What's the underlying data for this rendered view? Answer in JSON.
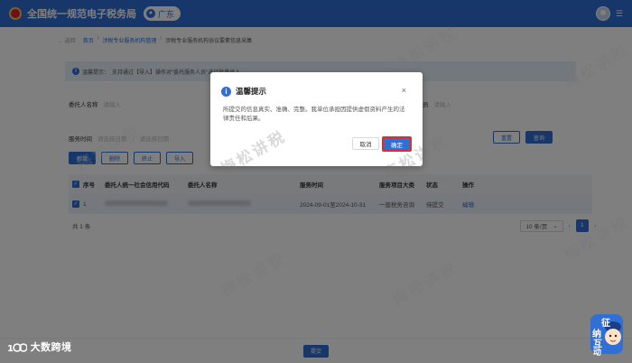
{
  "header": {
    "title": "全国统一规范电子税务局",
    "region": "广东"
  },
  "breadcrumb": {
    "back": "返回",
    "items": [
      "首页",
      "涉税专业服务机构管理",
      "涉税专业服务机构协议要素信息采集"
    ]
  },
  "notice": {
    "prefix": "温馨提示：",
    "text": "支持通过【导入】操作对\"委托服务人员\"进行批量录入。"
  },
  "filters": {
    "client_name_label": "委托人名称",
    "client_name_placeholder": "请输入",
    "service_time_label": "服务时间",
    "start_placeholder": "请选择日期",
    "end_placeholder": "请选择日期",
    "right_label": "员",
    "right_placeholder": "请输入",
    "reset": "重置",
    "search": "查询"
  },
  "toolbar": [
    "新增",
    "删除",
    "终止",
    "导入"
  ],
  "table": {
    "columns": [
      "序号",
      "委托人统一社会信用代码",
      "委托人名称",
      "服务时间",
      "服务项目大类",
      "状态",
      "操作"
    ],
    "rows": [
      {
        "no": "1",
        "time": "2024-09-01至2024-10-31",
        "type": "一般税务咨询",
        "status": "待提交",
        "action": "编辑"
      }
    ]
  },
  "pager": {
    "total": "共 1 条",
    "page_size": "10 条/页",
    "current_page": "1"
  },
  "submit": "提交",
  "dialog": {
    "title": "温馨提示",
    "body": "所提交的信息真实、准确、完整。我单位承担因提供虚假资料产生的法律责任和后果。",
    "cancel": "取消",
    "confirm": "确定"
  },
  "watermark": "梅松讲税",
  "brand": "大数跨境",
  "mascot": [
    "征",
    "纳",
    "互",
    "动"
  ],
  "colors": {
    "primary": "#2f6fd6",
    "highlight": "#e02b2b"
  }
}
